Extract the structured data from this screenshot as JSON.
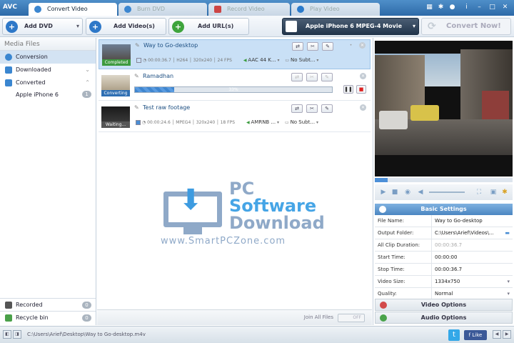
{
  "app": {
    "logo": "AVC"
  },
  "tabs": [
    {
      "label": "Convert Video",
      "active": true
    },
    {
      "label": "Burn DVD",
      "active": false
    },
    {
      "label": "Record Video",
      "active": false
    },
    {
      "label": "Play Video",
      "active": false
    }
  ],
  "toolbar": {
    "add_dvd": "Add DVD",
    "add_videos": "Add Video(s)",
    "add_urls": "Add URL(s)",
    "profile": "Apple iPhone 6 MPEG-4 Movie (*.mp4)",
    "convert_now": "Convert Now!"
  },
  "sidebar": {
    "header": "Media Files",
    "items": [
      {
        "label": "Conversion",
        "selected": true
      },
      {
        "label": "Downloaded"
      },
      {
        "label": "Converted"
      },
      {
        "label": "Apple iPhone 6",
        "count": "1"
      }
    ],
    "recorded": {
      "label": "Recorded",
      "count": "0"
    },
    "recycle": {
      "label": "Recycle bin",
      "count": "0"
    }
  },
  "files": [
    {
      "name": "Way to Go-desktop",
      "status": "Completed",
      "duration": "00:00:36.7",
      "codec": "H264",
      "resolution": "320x240",
      "fps": "24 FPS",
      "audio": "AAC 44 K...",
      "subtitle": "No Subt..."
    },
    {
      "name": "Ramadhan",
      "status": "Converting",
      "progress_label": "33%",
      "progress": 0.2
    },
    {
      "name": "Test raw footage",
      "status": "Waiting...",
      "duration": "00:00:24.6",
      "codec": "MPEG4",
      "resolution": "320x240",
      "fps": "18 FPS",
      "audio": "AMRNB ...",
      "subtitle": "No Subt..."
    }
  ],
  "list_footer": {
    "join_label": "Join All Files",
    "toggle": "OFF"
  },
  "settings": {
    "header": "Basic Settings",
    "rows": [
      {
        "key": "File Name:",
        "value": "Way to Go-desktop"
      },
      {
        "key": "Output Folder:",
        "value": "C:\\Users\\Arief\\Videos\\..."
      },
      {
        "key": "All Clip Duration:",
        "value": "00:00:36.7"
      },
      {
        "key": "Start Time:",
        "value": "00:00:00"
      },
      {
        "key": "Stop Time:",
        "value": "00:00:36.7"
      },
      {
        "key": "Video Size:",
        "value": "1334x750"
      },
      {
        "key": "Quality:",
        "value": "Normal"
      }
    ],
    "video_options": "Video Options",
    "audio_options": "Audio Options"
  },
  "statusbar": {
    "path": "C:\\Users\\Arief\\Desktop\\Way to Go-desktop.m4v",
    "like": "Like"
  },
  "watermark": {
    "line1": "PC",
    "line2": "Software",
    "line3": "Download",
    "line4": "www.SmartPCZone.com"
  }
}
